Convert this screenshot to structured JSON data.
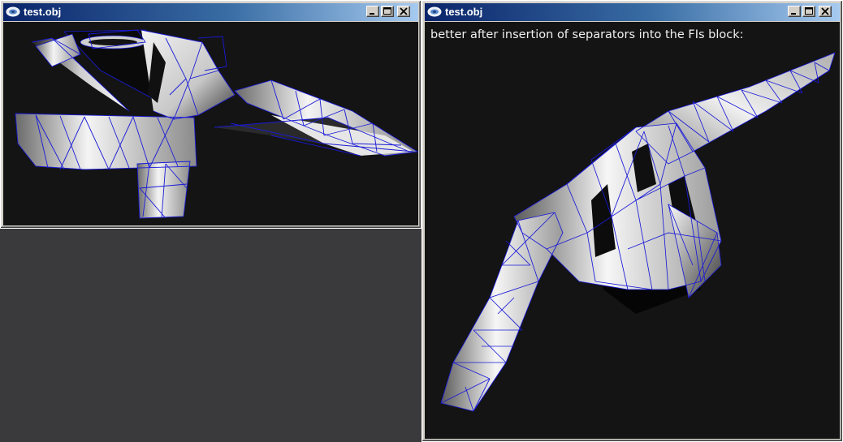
{
  "windows": [
    {
      "title": "test.obj",
      "caption": "",
      "controls": [
        "minimize",
        "maximize",
        "close"
      ]
    },
    {
      "title": "test.obj",
      "caption": "better after insertion of separators into the FIs block:",
      "controls": [
        "minimize",
        "maximize",
        "close"
      ]
    }
  ],
  "colors": {
    "desktop": "#3a3a3c",
    "titlebar_start": "#0a246a",
    "titlebar_end": "#a6caf0",
    "viewport_bg": "#141414",
    "wireframe": "#1a1ad8"
  },
  "icons": {
    "window_icon": "app-icon",
    "minimize": "minimize-icon",
    "maximize": "maximize-icon",
    "close": "close-icon"
  }
}
